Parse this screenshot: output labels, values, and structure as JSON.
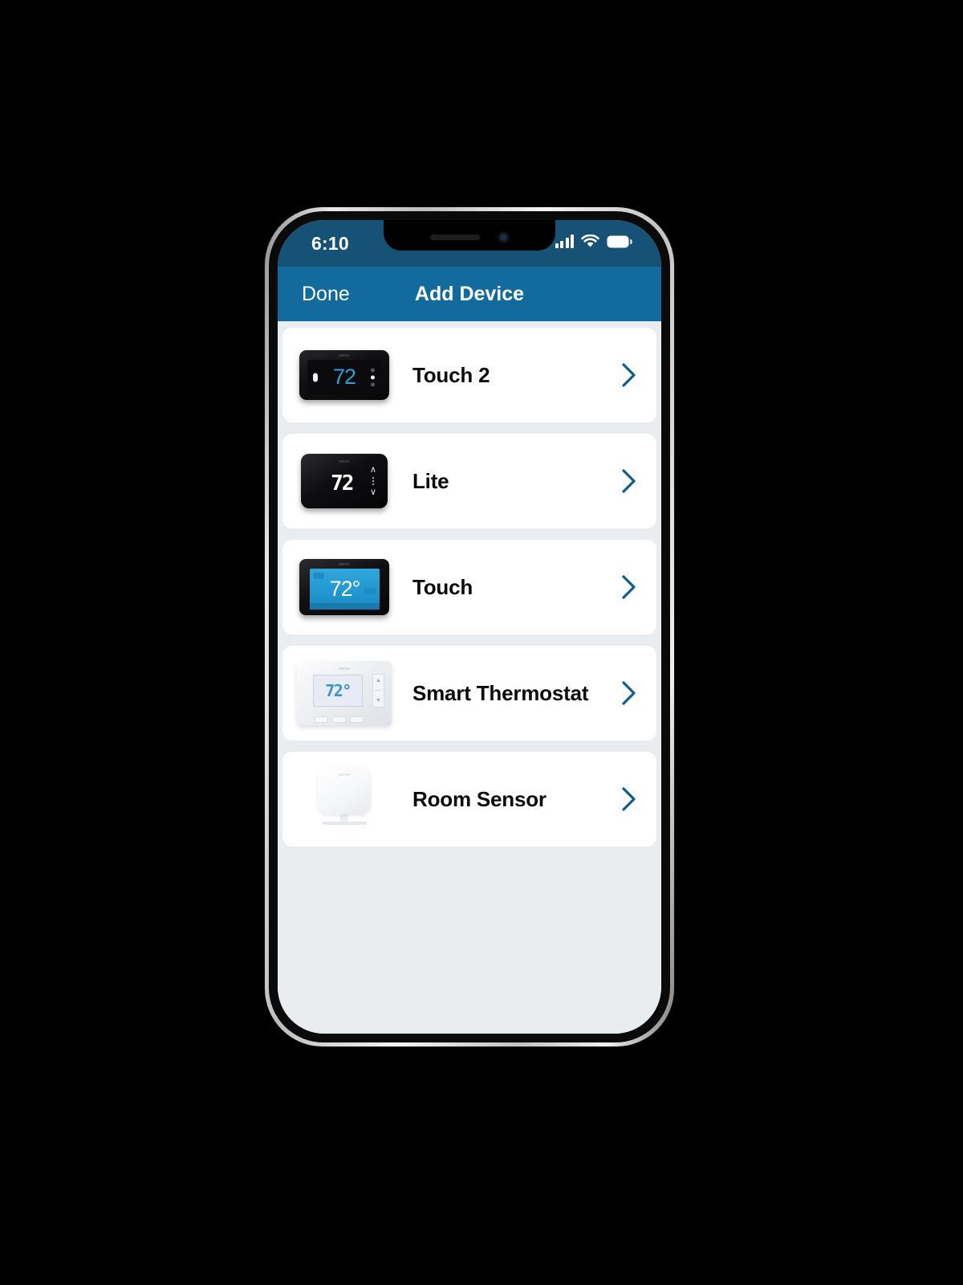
{
  "status_bar": {
    "time": "6:10",
    "cellular_icon": "signal-bars-icon",
    "cellular_bars": 4,
    "wifi_icon": "wifi-icon",
    "battery_icon": "battery-full-icon",
    "background_color": "#155275"
  },
  "nav_bar": {
    "done_label": "Done",
    "title": "Add Device",
    "background_color": "#136a9d",
    "text_color": "#ffffff"
  },
  "screen": {
    "background_color": "#e9edf0",
    "card_color": "#ffffff",
    "accent_color": "#0e5f8a"
  },
  "devices": [
    {
      "label": "Touch 2",
      "thumbnail": "sensi-touch-2-thermostat",
      "brand": "sensi",
      "display_temperature": "72",
      "chevron_icon": "chevron-right-icon"
    },
    {
      "label": "Lite",
      "thumbnail": "sensi-lite-thermostat",
      "brand": "sensi",
      "display_temperature": "72",
      "chevron_icon": "chevron-right-icon"
    },
    {
      "label": "Touch",
      "thumbnail": "sensi-touch-thermostat",
      "brand": "sensi",
      "display_temperature": "72°",
      "chevron_icon": "chevron-right-icon"
    },
    {
      "label": "Smart Thermostat",
      "thumbnail": "sensi-smart-thermostat",
      "brand": "sensi",
      "display_temperature": "72°",
      "chevron_icon": "chevron-right-icon"
    },
    {
      "label": "Room Sensor",
      "thumbnail": "sensi-room-sensor",
      "brand": "sensi",
      "display_temperature": "",
      "chevron_icon": "chevron-right-icon"
    }
  ]
}
